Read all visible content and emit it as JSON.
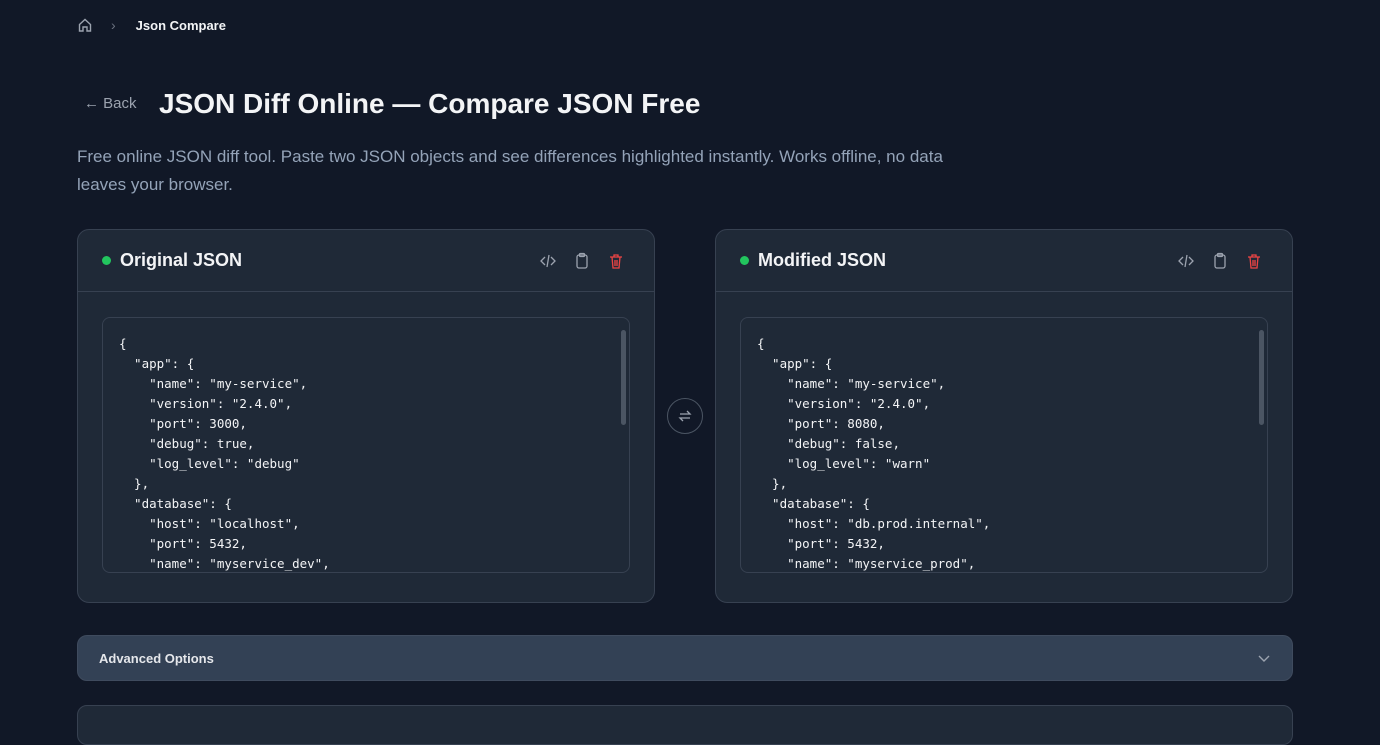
{
  "breadcrumb": {
    "current": "Json Compare"
  },
  "header": {
    "back": "← Back",
    "title": "JSON Diff Online — Compare JSON Free",
    "description": "Free online JSON diff tool. Paste two JSON objects and see differences highlighted instantly. Works offline, no data leaves your browser."
  },
  "original": {
    "title": "Original JSON",
    "content": "{\n  \"app\": {\n    \"name\": \"my-service\",\n    \"version\": \"2.4.0\",\n    \"port\": 3000,\n    \"debug\": true,\n    \"log_level\": \"debug\"\n  },\n  \"database\": {\n    \"host\": \"localhost\",\n    \"port\": 5432,\n    \"name\": \"myservice_dev\","
  },
  "modified": {
    "title": "Modified JSON",
    "content": "{\n  \"app\": {\n    \"name\": \"my-service\",\n    \"version\": \"2.4.0\",\n    \"port\": 8080,\n    \"debug\": false,\n    \"log_level\": \"warn\"\n  },\n  \"database\": {\n    \"host\": \"db.prod.internal\",\n    \"port\": 5432,\n    \"name\": \"myservice_prod\","
  },
  "advanced": {
    "label": "Advanced Options"
  },
  "colors": {
    "status": "#22c55e",
    "delete": "#ef4444",
    "background": "#111827",
    "card": "#1f2937"
  }
}
